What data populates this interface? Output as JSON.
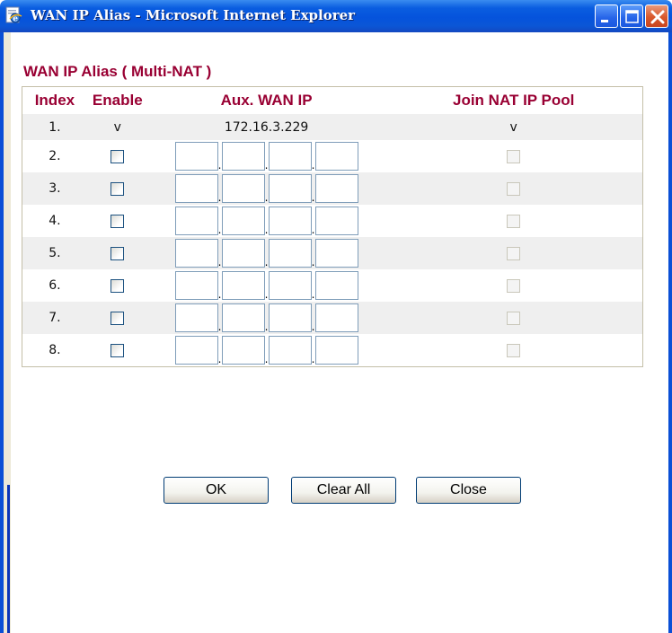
{
  "window": {
    "title": "WAN IP Alias - Microsoft Internet Explorer",
    "icon": "ie-page-icon",
    "controls": [
      "minimize-icon",
      "maximize-icon",
      "close-icon"
    ]
  },
  "section": {
    "title": "WAN IP Alias ( Multi-NAT )"
  },
  "table": {
    "headers": {
      "index": "Index",
      "enable": "Enable",
      "aux_ip": "Aux. WAN IP",
      "pool": "Join NAT IP Pool"
    },
    "static_row": {
      "index": "1.",
      "enable": "v",
      "ip": "172.16.3.229",
      "pool": "v"
    },
    "rows": [
      {
        "index": "2.",
        "enable": false,
        "octets": [
          "",
          "",
          "",
          ""
        ],
        "pool": false
      },
      {
        "index": "3.",
        "enable": false,
        "octets": [
          "",
          "",
          "",
          ""
        ],
        "pool": false
      },
      {
        "index": "4.",
        "enable": false,
        "octets": [
          "",
          "",
          "",
          ""
        ],
        "pool": false
      },
      {
        "index": "5.",
        "enable": false,
        "octets": [
          "",
          "",
          "",
          ""
        ],
        "pool": false
      },
      {
        "index": "6.",
        "enable": false,
        "octets": [
          "",
          "",
          "",
          ""
        ],
        "pool": false
      },
      {
        "index": "7.",
        "enable": false,
        "octets": [
          "",
          "",
          "",
          ""
        ],
        "pool": false
      },
      {
        "index": "8.",
        "enable": false,
        "octets": [
          "",
          "",
          "",
          ""
        ],
        "pool": false
      }
    ]
  },
  "buttons": {
    "ok": "OK",
    "clear_all": "Clear All",
    "close": "Close"
  },
  "colors": {
    "accent": "#990033",
    "titlebar": "#0553dc",
    "row_shade": "#efefef"
  }
}
